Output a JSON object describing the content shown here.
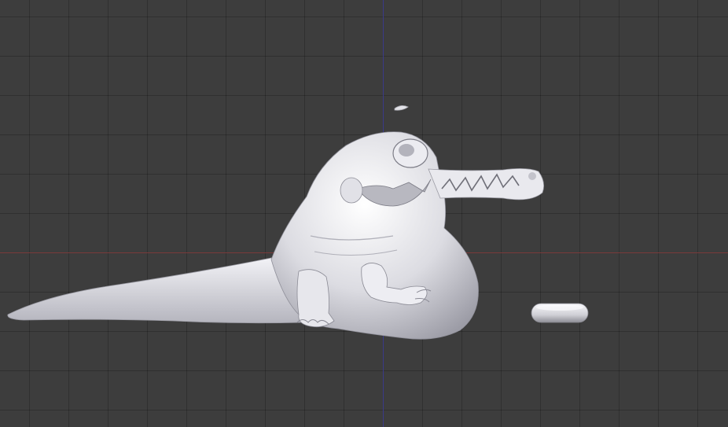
{
  "viewport": {
    "background_color": "#3d3d3d",
    "grid_line_color": "#2e2e2e",
    "x_axis_color": "#7a3a3a",
    "z_axis_color": "#3a3a8a",
    "mesh_color": "#e6e6ea",
    "objects": [
      {
        "name": "crocodile-sculpt-mesh"
      },
      {
        "name": "torus-ring-mesh"
      },
      {
        "name": "small-fragment-mesh"
      }
    ]
  }
}
